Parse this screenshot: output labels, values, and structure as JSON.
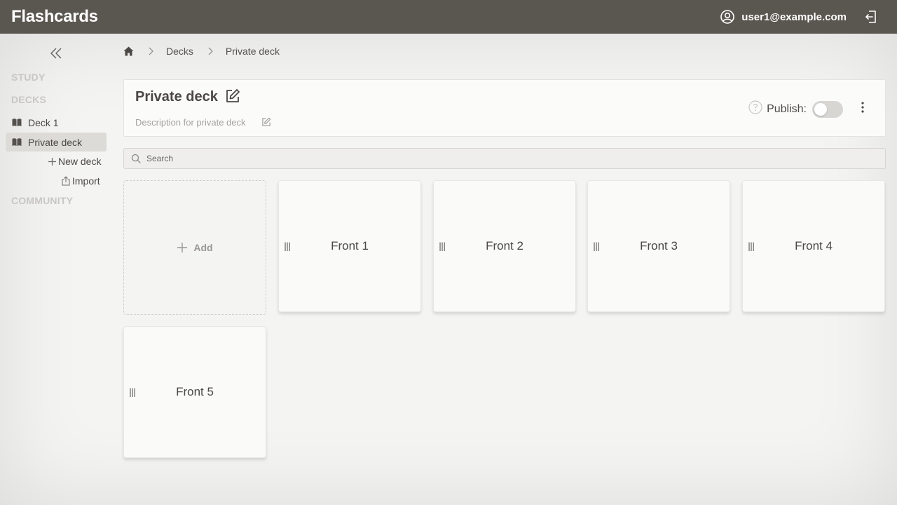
{
  "app": {
    "title": "Flashcards"
  },
  "user": {
    "email": "user1@example.com"
  },
  "sidebar": {
    "study_label": "STUDY",
    "decks_label": "DECKS",
    "items": [
      {
        "label": "Deck 1",
        "active": false
      },
      {
        "label": "Private deck",
        "active": true
      }
    ],
    "new_deck_label": "New deck",
    "import_label": "Import",
    "community_label": "COMMUNITY"
  },
  "breadcrumb": {
    "items": [
      "Decks",
      "Private deck"
    ]
  },
  "deck": {
    "title": "Private deck",
    "description": "Description for private deck",
    "publish_label": "Publish:",
    "published": false
  },
  "search": {
    "placeholder": "Search",
    "value": ""
  },
  "cards": {
    "add_label": "Add",
    "handle_glyph": "|||",
    "items": [
      {
        "front": "Front 1"
      },
      {
        "front": "Front 2"
      },
      {
        "front": "Front 3"
      },
      {
        "front": "Front 4"
      },
      {
        "front": "Front 5"
      }
    ]
  },
  "colors": {
    "header_bg": "#5a5650",
    "page_bg": "#f4f4f2",
    "active_item_bg": "#dcdbd8",
    "muted_section": "#c9c7c4"
  }
}
